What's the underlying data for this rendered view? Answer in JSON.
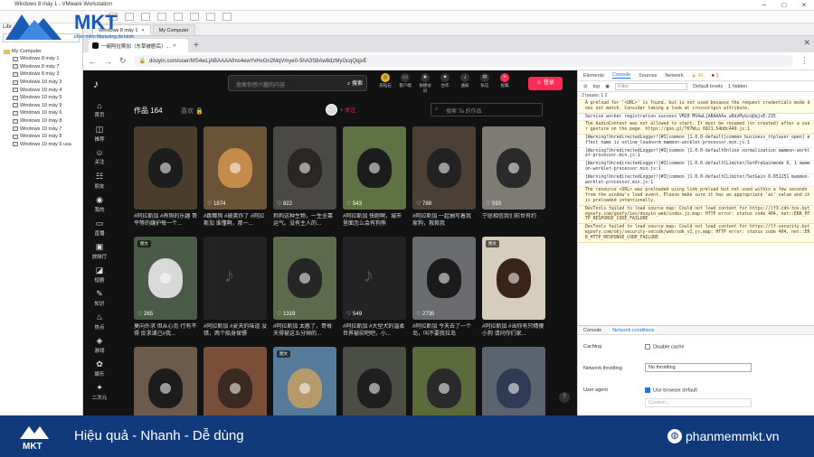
{
  "vmware": {
    "title": "Windows 8 máy 1 - VMware Workstation",
    "tabs": [
      "Windows 8 máy 1",
      "My Computer"
    ],
    "library_label": "Libr",
    "tree_root": "My Computer",
    "vms": [
      "Windows 8 máy 1",
      "Windows 8 máy 7",
      "Windows 8 máy 3",
      "Windows 10 máy 3",
      "Windows 10 máy 4",
      "Windows 10 máy 5",
      "Windows 10 máy 9",
      "Windows 10 máy 6",
      "Windows 10 máy 8",
      "Windows 10 máy 7",
      "Windows 10 máy 8",
      "Windows 10 máy 9 usa"
    ]
  },
  "browser": {
    "tab_title": "一碗阿拉斯加（东草被剧后）...",
    "url": "douyin.com/user/MS4wLjABAAAAfms4ewYvHvGn2MqVmye0-5hA3S8Aw8dzMyGcqQqjvE"
  },
  "tiktok": {
    "search_placeholder": "搜索你感兴趣的内容",
    "search_button": "搜索",
    "top_icons": [
      {
        "label": "充钻石",
        "glyph": "◎",
        "color": "gold"
      },
      {
        "label": "客户端",
        "glyph": "▭",
        "color": "dark"
      },
      {
        "label": "快捷访问",
        "glyph": "★",
        "color": "dark"
      },
      {
        "label": "合作",
        "glyph": "♥",
        "color": "dark"
      },
      {
        "label": "通知",
        "glyph": "♪",
        "color": "dark"
      },
      {
        "label": "私信",
        "glyph": "✉",
        "color": "dark"
      },
      {
        "label": "投稿",
        "glyph": "+",
        "color": "dark"
      }
    ],
    "new_badge": "NEW",
    "login": "登录",
    "nav": [
      {
        "label": "首页",
        "icon": "home-icon",
        "glyph": "⌂"
      },
      {
        "label": "推荐",
        "icon": "recommend-icon",
        "glyph": "◫"
      },
      {
        "label": "关注",
        "icon": "follow-icon",
        "glyph": "☺"
      },
      {
        "label": "朋友",
        "icon": "friends-icon",
        "glyph": "☷"
      },
      {
        "label": "我的",
        "icon": "me-icon",
        "glyph": "◉"
      },
      {
        "label": "直播",
        "icon": "live-icon",
        "glyph": "▭"
      },
      {
        "label": "放映厅",
        "icon": "cinema-icon",
        "glyph": "▣"
      },
      {
        "label": "短剧",
        "icon": "drama-icon",
        "glyph": "◪"
      },
      {
        "label": "知识",
        "icon": "knowledge-icon",
        "glyph": "✎"
      },
      {
        "label": "热点",
        "icon": "hot-icon",
        "glyph": "♨"
      },
      {
        "label": "游戏",
        "icon": "game-icon",
        "glyph": "◈"
      },
      {
        "label": "娱乐",
        "icon": "entertain-icon",
        "glyph": "✿"
      },
      {
        "label": "二次元",
        "icon": "anime-icon",
        "glyph": "✦"
      }
    ],
    "works_label": "作品 164",
    "likes_tab": "喜欢",
    "follow": "+ 关注",
    "search_works_placeholder": "搜索 Ta 的作品",
    "videos": [
      {
        "likes": "",
        "caption": "#阿拉斯加 #养狗的乐趣 哥平等的嫌护每一个...",
        "bg": "#4a3d2c",
        "dog": "#1d1d1d",
        "badge": ""
      },
      {
        "likes": "1874",
        "caption": "#跳舞狗 #被笑炸了 #阿拉斯加 谁懂啊，那一...",
        "bg": "#6b5338",
        "dog": "#c58b4a",
        "badge": ""
      },
      {
        "likes": "822",
        "caption": "狗狗这种生物，一生全靠运气。没有主人的...",
        "bg": "#4b4945",
        "dog": "#2a2624",
        "badge": ""
      },
      {
        "likes": "543",
        "caption": "#阿拉斯加 快跑啊，城市里面怎么会有狗熊",
        "bg": "#5f7243",
        "dog": "#1c1c1c",
        "badge": ""
      },
      {
        "likes": "788",
        "caption": "#阿拉斯加 一起抽写着我家狗，救救我",
        "bg": "#4b3f36",
        "dog": "#222222",
        "badge": ""
      },
      {
        "likes": "593",
        "caption": "宁愿相信我们前世有约",
        "bg": "#7e7a74",
        "dog": "#2a2a2a",
        "badge": ""
      },
      {
        "likes": "265",
        "caption": "莫向外求 但从心觅 行有不得 反求诸己#我...",
        "bg": "#4a5c48",
        "dog": "#d9d9d9",
        "badge": "图文"
      },
      {
        "likes": "",
        "caption": "#阿拉斯加 #夏天的味道 没错，两个船身保镖",
        "bg": "#232323",
        "dog": "",
        "badge": ""
      },
      {
        "likes": "1319",
        "caption": "#阿拉斯加 太憨了，哥每天得被这五分钟的...",
        "bg": "#5d6a4b",
        "dog": "#262626",
        "badge": ""
      },
      {
        "likes": "549",
        "caption": "#阿拉斯加 #大型犬的温柔 世界被砍吧吧，小...",
        "bg": "#232323",
        "dog": "",
        "badge": ""
      },
      {
        "likes": "2735",
        "caption": "#阿拉斯加 今天去了一个岛，叫不要我拉岛",
        "bg": "#6a6c70",
        "dog": "#1b1b1b",
        "badge": ""
      },
      {
        "likes": "",
        "caption": "#阿拉斯加 #当你有只精傻小狗 请问你们家...",
        "bg": "#d6cdbd",
        "dog": "#3a2418",
        "badge": "图文"
      },
      {
        "likes": "",
        "caption": "",
        "bg": "#6c5a4a",
        "dog": "#1c1c1c",
        "badge": ""
      },
      {
        "likes": "",
        "caption": "",
        "bg": "#7a4f3a",
        "dog": "#3a2a20",
        "badge": ""
      },
      {
        "likes": "",
        "caption": "",
        "bg": "#567a9a",
        "dog": "#b79a6a",
        "badge": "图文"
      },
      {
        "likes": "",
        "caption": "",
        "bg": "#4b4e44",
        "dog": "#1f1f1f",
        "badge": ""
      },
      {
        "likes": "",
        "caption": "",
        "bg": "#5b6a3a",
        "dog": "#2a2a2a",
        "badge": ""
      },
      {
        "likes": "",
        "caption": "",
        "bg": "#5a6470",
        "dog": "#2f3b55",
        "badge": ""
      }
    ],
    "help": "?"
  },
  "devtools": {
    "tabs": [
      "Elements",
      "Console",
      "Sources",
      "Network"
    ],
    "active_tab": "Console",
    "warn_count": "40",
    "err_count": "1",
    "context": "top",
    "filter_placeholder": "Filter",
    "levels": "Default levels",
    "hidden": "1 hidden",
    "issues": "2 Issues: 1 2",
    "logs": [
      {
        "t": "A preload for '<URL>' is found, but is not used because the request credentials mode does not match. Consider taking a look at crossorigin attribute.",
        "plain": false
      },
      {
        "t": "Service worker registration success   VM10 MS4wLjABAAAAa_w8dzMyGcqQqjvE:235",
        "plain": true
      },
      {
        "t": "The AudioContext was not allowed to start. It must be resumed (or created) after a user gesture on the page. https://goo.gl/7K7WLu   6821.54b8c449.js:1",
        "plain": false
      },
      {
        "t": "[Warning!UnredirectedLogger!]#I[common ]1.0.0-default[common_business_ttplayer_open] effect name is online_loudnorm   mammon-worklet-processor.min.js:1",
        "plain": true
      },
      {
        "t": "[Warning!UnredirectedLogger!]#I[common ]1.0.0-defaultOnline normalization   mammon-worklet-processor.min.js:1",
        "plain": true
      },
      {
        "t": "[Warning!UnredirectedLogger!]#I[common ]1.0.0-defaultCLimiter/SetPreGainmode 0, 1   mammon-worklet-processor.min.js:1",
        "plain": true
      },
      {
        "t": "[Warning!UnredirectedLogger!]#I[common ]1.0.0-defaultCLimiter/SetGain 0.051251   mammon-worklet-processor.min.js:1",
        "plain": true
      },
      {
        "t": "The resource <URL> was preloaded using link preload but not used within a few seconds from the window's load event. Please make sure it has an appropriate 'as' value and it is preloaded intentionally.",
        "plain": false
      },
      {
        "t": "DevTools failed to load source map: Could not load content for https://lf3-cdn-tos.bytegoofy.com/goofy/ies/douyin_web/index.js.map: HTTP error: status code 404, net::ERR_HTTP_RESPONSE_CODE_FAILURE",
        "plain": false
      },
      {
        "t": "DevTools failed to load source map: Could not load content for https://lf-security.bytegoofy.com/obj/security-secsdk/web/sdk_v1.js.map: HTTP error: status code 404, net::ERR_HTTP_RESPONSE_CODE_FAILURE",
        "plain": false
      }
    ],
    "lower_tabs": [
      "Console",
      "Network conditions"
    ],
    "caching_label": "Caching",
    "disable_cache": "Disable cache",
    "throttling_label": "Network throttling",
    "throttling_value": "No throttling",
    "ua_label": "User agent",
    "use_default": "Use browser default",
    "ua_select": "Custom..."
  },
  "banner": {
    "slogan": "Hiệu quả - Nhanh - Dễ dùng",
    "site": "phanmemmkt.vn",
    "logo_text": "MKT",
    "logo_sub": "phần mềm Marketing đa kênh"
  },
  "colors": {
    "banner": "#113a7c",
    "accent": "#fe2c55",
    "brand": "#1a5bb5"
  }
}
